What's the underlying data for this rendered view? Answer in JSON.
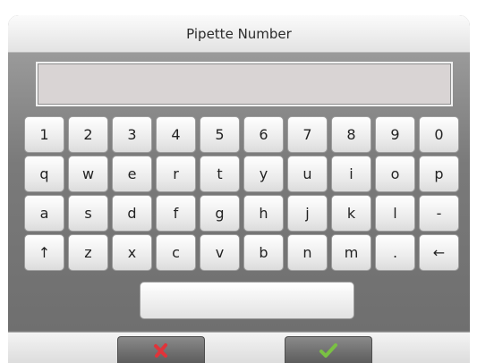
{
  "title": "Pipette Number",
  "entry": {
    "value": ""
  },
  "keyboard": {
    "row1": [
      "1",
      "2",
      "3",
      "4",
      "5",
      "6",
      "7",
      "8",
      "9",
      "0"
    ],
    "row2": [
      "q",
      "w",
      "e",
      "r",
      "t",
      "y",
      "u",
      "i",
      "o",
      "p"
    ],
    "row3": [
      "a",
      "s",
      "d",
      "f",
      "g",
      "h",
      "j",
      "k",
      "l",
      "-"
    ],
    "row4": [
      "↑",
      "z",
      "x",
      "c",
      "v",
      "b",
      "n",
      "m",
      ".",
      "←"
    ]
  },
  "icons": {
    "cancel": "x-icon",
    "confirm": "checkmark-icon"
  },
  "colors": {
    "cancel": "#e0343a",
    "confirm": "#7ac143"
  }
}
